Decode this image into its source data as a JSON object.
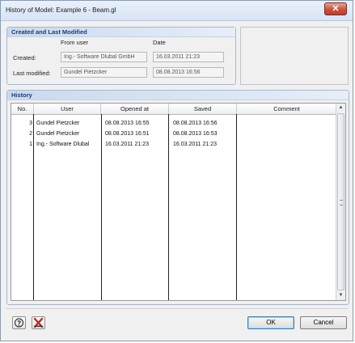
{
  "window": {
    "title": "History of Model: Example 6 - Beam.gl"
  },
  "created_group": {
    "title": "Created and Last Modified",
    "from_user_header": "From user",
    "date_header": "Date",
    "created_label": "Created:",
    "created_user": "Ing.- Software Dlubal GmbH",
    "created_date": "16.03.2011 21:23",
    "modified_label": "Last modified:",
    "modified_user": "Gundel Pietzcker",
    "modified_date": "08.08.2013 16:56"
  },
  "history_group": {
    "title": "History",
    "columns": [
      "No.",
      "User",
      "Opened at",
      "Saved",
      "Comment"
    ],
    "rows": [
      {
        "no": "3",
        "user": "Gundel Pietzcker",
        "opened": "08.08.2013 16:55",
        "saved": "08.08.2013 16:56",
        "comment": ""
      },
      {
        "no": "2",
        "user": "Gundel Pietzcker",
        "opened": "08.08.2013 16:51",
        "saved": "08.08.2013 16:53",
        "comment": ""
      },
      {
        "no": "1",
        "user": "Ing.- Software Dlubal",
        "opened": "16.03.2011 21:23",
        "saved": "16.03.2011 21:23",
        "comment": ""
      }
    ]
  },
  "footer": {
    "ok_label": "OK",
    "cancel_label": "Cancel"
  },
  "icons": {
    "help": "help-icon",
    "delete": "delete-icon",
    "close": "close-icon"
  }
}
